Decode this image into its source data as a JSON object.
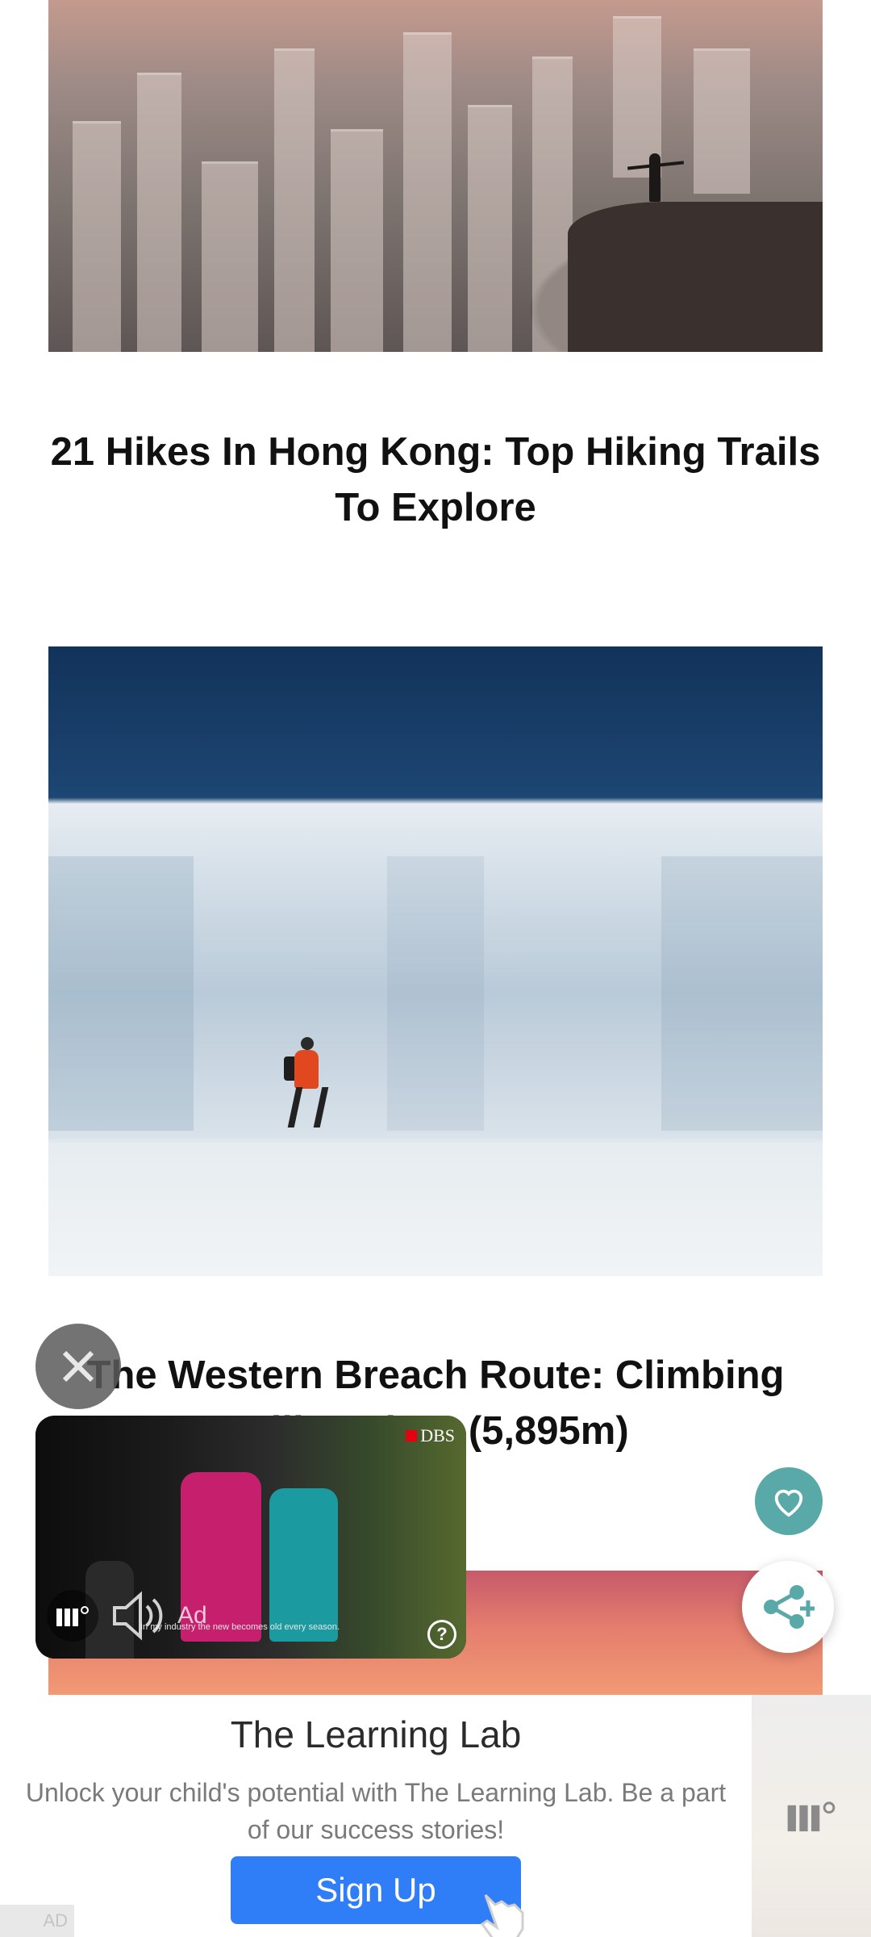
{
  "articles": [
    {
      "title": "21 Hikes In Hong Kong: Top Hiking Trails To Explore"
    },
    {
      "title": "The Western Breach Route: Climbing Kilimanjaro (5,895m)"
    }
  ],
  "video_ad": {
    "brand": "DBS",
    "caption": "In my industry the new becomes old every season.",
    "label": "Ad"
  },
  "banner_ad": {
    "title": "The Learning Lab",
    "description": "Unlock your child's potential with The Learning Lab. Be a part of our success stories!",
    "cta": "Sign Up",
    "tag": "AD"
  },
  "colors": {
    "favorite_button": "#5aa9a9",
    "cta": "#2f7ef7"
  },
  "icons": [
    "close-icon",
    "heart-icon",
    "share-icon",
    "speaker-icon",
    "help-icon",
    "hand-pointer-icon"
  ]
}
